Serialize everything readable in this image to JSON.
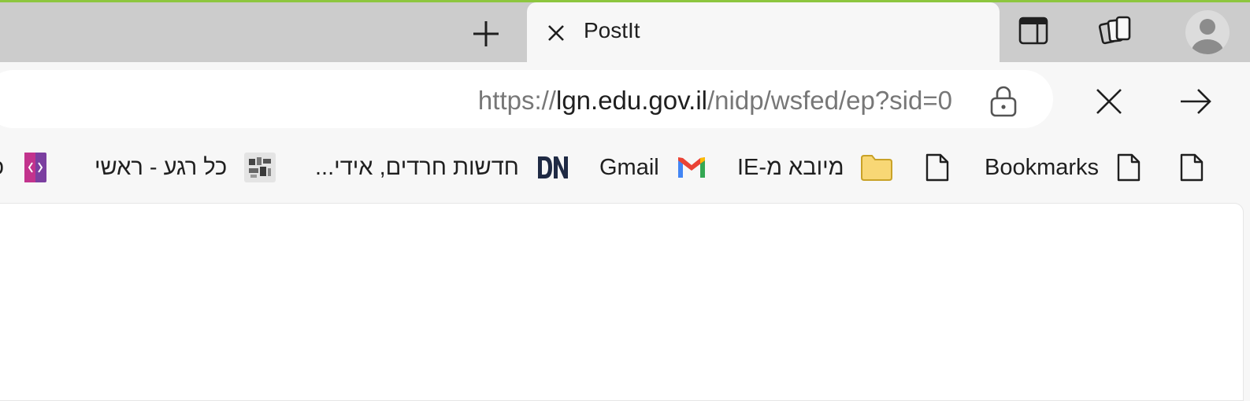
{
  "tabstrip": {
    "new_tab_icon": "plus-icon",
    "active_tab": {
      "title": "PostIt",
      "close_icon": "close-icon"
    },
    "toolbar_icons": [
      "split-screen-icon",
      "collections-icon",
      "profile-avatar-icon"
    ]
  },
  "addressbar": {
    "url_prefix": "https://",
    "url_host": "lgn.edu.gov.il",
    "url_path": "/nidp/wsfed/ep?sid=0",
    "lock_icon": "lock-icon",
    "stop_icon": "close-icon",
    "go_icon": "arrow-right-icon"
  },
  "bookmarks": {
    "items": [
      {
        "label": "",
        "icon": "page-icon"
      },
      {
        "label": "Bookmarks",
        "icon": "page-icon"
      },
      {
        "label": "",
        "icon": "page-icon"
      },
      {
        "label": "מיובא מ-IE",
        "icon": "folder-icon"
      },
      {
        "label": "Gmail",
        "icon": "gmail-icon"
      },
      {
        "label": "חדשות חרדים, אידי...",
        "icon": "dn-icon"
      },
      {
        "label": "כל רגע - ראשי",
        "icon": "site-favicon-icon"
      },
      {
        "label": "כ",
        "icon": "code-icon"
      }
    ]
  },
  "colors": {
    "tabstrip_bg": "#cccccc",
    "toolbar_bg": "#f7f7f7",
    "accent_line": "#8dc63f",
    "folder": "#f8d775"
  }
}
